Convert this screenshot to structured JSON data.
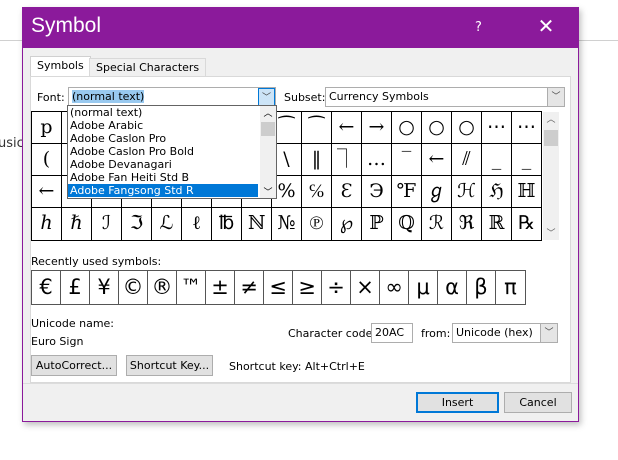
{
  "background": {
    "text": "usic"
  },
  "title": "Symbol",
  "help_label": "?",
  "close_label": "✕",
  "tabs": [
    {
      "label": "Symbols",
      "active": true
    },
    {
      "label": "Special Characters",
      "active": false
    }
  ],
  "font": {
    "label": "Font:",
    "value": "(normal text)"
  },
  "subset": {
    "label": "Subset:",
    "value": "Currency Symbols"
  },
  "font_dropdown": {
    "items": [
      "(normal text)",
      "Adobe Arabic",
      "Adobe Caslon Pro",
      "Adobe Caslon Pro Bold",
      "Adobe Devanagari",
      "Adobe Fan Heiti Std B",
      "Adobe Fangsong Std R"
    ],
    "highlighted": "Adobe Fangsong Std R"
  },
  "symbol_grid": [
    [
      "p",
      "",
      "",
      "",
      "",
      "",
      "",
      "",
      "⁀",
      "⁀",
      "←",
      "→",
      "○",
      "○",
      "○",
      "⋯",
      "⋯"
    ],
    [
      "(",
      "",
      "",
      "",
      "",
      "",
      "",
      "",
      "\\",
      "‖",
      "⏋",
      "…",
      "‾",
      "←",
      "⫽",
      "_",
      "_"
    ],
    [
      "←",
      "→",
      "",
      "",
      "",
      "",
      "",
      "",
      "%",
      "℅",
      "Ɛ",
      "Э",
      "℉",
      "ℊ",
      "ℋ",
      "ℌ",
      "ℍ"
    ],
    [
      "ℎ",
      "ℏ",
      "ℐ",
      "ℑ",
      "ℒ",
      "ℓ",
      "℔",
      "ℕ",
      "№",
      "℗",
      "℘",
      "ℙ",
      "ℚ",
      "ℛ",
      "ℜ",
      "ℝ",
      "℞"
    ]
  ],
  "recent": {
    "label": "Recently used symbols:",
    "symbols": [
      "€",
      "£",
      "¥",
      "©",
      "®",
      "™",
      "±",
      "≠",
      "≤",
      "≥",
      "÷",
      "×",
      "∞",
      "μ",
      "α",
      "β",
      "π"
    ]
  },
  "unicode_name": {
    "label": "Unicode name:",
    "value": "Euro Sign"
  },
  "character_code": {
    "label": "Character code:",
    "value": "20AC"
  },
  "from": {
    "label": "from:",
    "value": "Unicode (hex)"
  },
  "autocorrect_label": "AutoCorrect...",
  "shortcut_key_label": "Shortcut Key...",
  "shortcut_text": "Shortcut key: Alt+Ctrl+E",
  "insert_label": "Insert",
  "cancel_label": "Cancel",
  "colors": {
    "titlebar": "#8b1a9b",
    "highlight": "#0078d7"
  }
}
